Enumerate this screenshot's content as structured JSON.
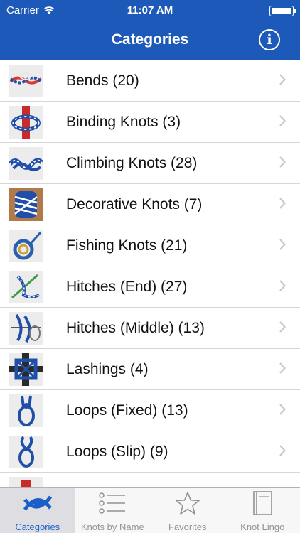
{
  "status": {
    "carrier": "Carrier",
    "time": "11:07 AM"
  },
  "nav": {
    "title": "Categories",
    "info_symbol": "i"
  },
  "categories": [
    {
      "label": "Bends (20)",
      "thumb": "bends-thumbnail"
    },
    {
      "label": "Binding Knots (3)",
      "thumb": "binding-thumbnail"
    },
    {
      "label": "Climbing Knots (28)",
      "thumb": "climbing-thumbnail"
    },
    {
      "label": "Decorative Knots (7)",
      "thumb": "decorative-thumbnail"
    },
    {
      "label": "Fishing Knots (21)",
      "thumb": "fishing-thumbnail"
    },
    {
      "label": "Hitches (End) (27)",
      "thumb": "hitches-end-thumbnail"
    },
    {
      "label": "Hitches (Middle) (13)",
      "thumb": "hitches-middle-thumbnail"
    },
    {
      "label": "Lashings (4)",
      "thumb": "lashings-thumbnail"
    },
    {
      "label": "Loops (Fixed) (13)",
      "thumb": "loops-fixed-thumbnail"
    },
    {
      "label": "Loops (Slip) (9)",
      "thumb": "loops-slip-thumbnail"
    }
  ],
  "tabs": [
    {
      "label": "Categories",
      "icon": "knot-icon",
      "active": true
    },
    {
      "label": "Knots by Name",
      "icon": "list-icon",
      "active": false
    },
    {
      "label": "Favorites",
      "icon": "star-icon",
      "active": false
    },
    {
      "label": "Knot Lingo",
      "icon": "book-icon",
      "active": false
    }
  ],
  "colors": {
    "nav_bar": "#1d59b8",
    "tab_active": "#1a5fc8",
    "tab_inactive": "#929292"
  }
}
